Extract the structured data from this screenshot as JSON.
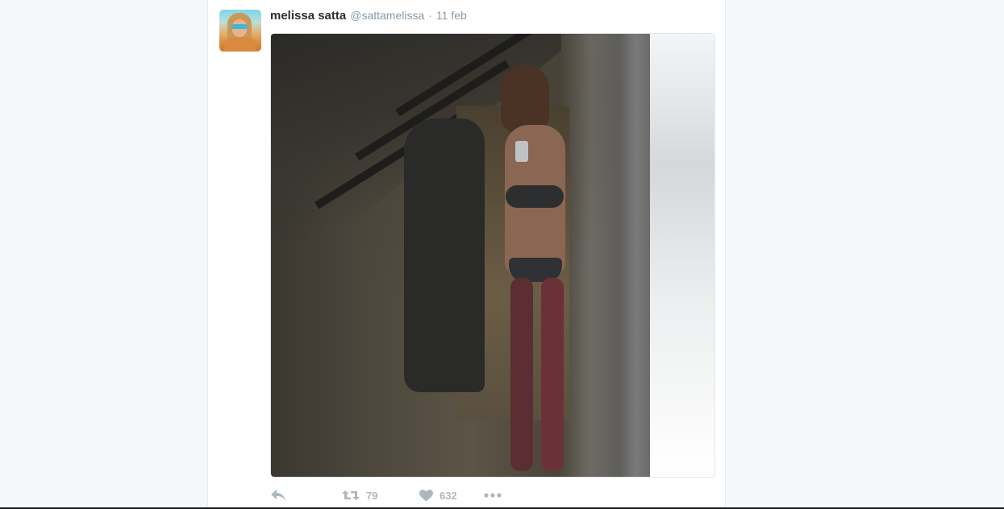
{
  "tweet": {
    "fullname": "melissa satta",
    "username": "@sattamelissa",
    "separator": "·",
    "time": "11 feb",
    "avatar_icon": "profile-photo",
    "media_icon": "photo"
  },
  "actions": {
    "reply_icon": "reply-icon",
    "retweet_count": "79",
    "like_count": "632",
    "more_icon": "more-icon"
  },
  "colors": {
    "page_bg": "#f5f8fa",
    "card_bg": "#ffffff",
    "name": "#292f33",
    "meta": "#8899a6",
    "action": "#aab8c2"
  }
}
